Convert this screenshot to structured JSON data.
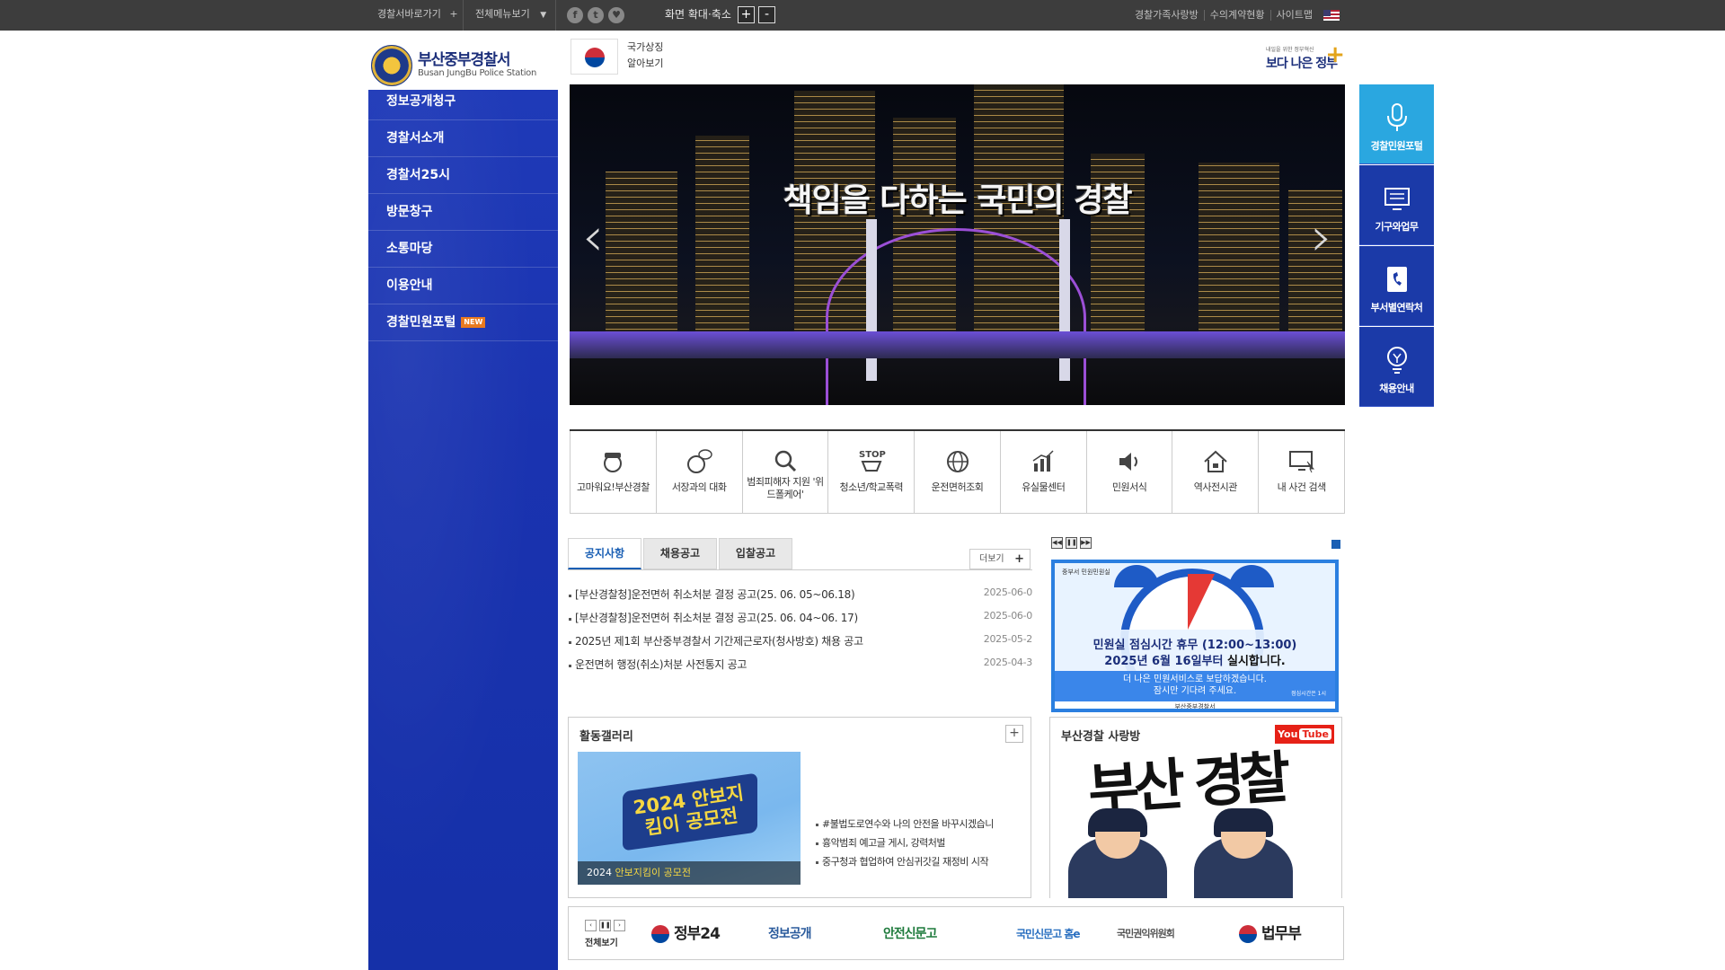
{
  "topbar": {
    "shortcut_label": "경찰서바로가기",
    "allmenu_label": "전체메뉴보기",
    "zoom_label": "화면 확대·축소",
    "zoom_in": "+",
    "zoom_out": "-",
    "links": [
      "경찰가족사랑방",
      "수의계약현황",
      "사이트맵"
    ]
  },
  "logo": {
    "korean": "부산중부경찰서",
    "english": "Busan JungBu Police Station"
  },
  "national_symbol": {
    "line1": "국가상징",
    "line2": "알아보기"
  },
  "gov_logo": {
    "slogan": "내일을 위한 정부혁신",
    "text": "보다 나은 정부"
  },
  "nav": {
    "items": [
      "정보공개청구",
      "경찰서소개",
      "경찰서25시",
      "방문창구",
      "소통마당",
      "이용안내",
      "경찰민원포털"
    ],
    "new_badge": "NEW"
  },
  "hero": {
    "title": "책임을 다하는 국민의 경찰",
    "prev": "‹",
    "next": "›"
  },
  "quick_menu": [
    {
      "label": "고마워요!부산경찰",
      "icon": "police-officer-icon"
    },
    {
      "label": "서장과의 대화",
      "icon": "chat-icon"
    },
    {
      "label": "범죄피해자 지원 '위드폴케어'",
      "icon": "magnifier-icon"
    },
    {
      "label": "청소년/학교폭력",
      "icon": "stop-icon"
    },
    {
      "label": "운전면허조회",
      "icon": "globe-icon"
    },
    {
      "label": "유실물센터",
      "icon": "chart-icon"
    },
    {
      "label": "민원서식",
      "icon": "speaker-icon"
    },
    {
      "label": "역사전시관",
      "icon": "house-icon"
    },
    {
      "label": "내 사건 검색",
      "icon": "monitor-icon"
    }
  ],
  "notice_tabs": [
    "공지사항",
    "채용공고",
    "입찰공고"
  ],
  "more_label": "더보기",
  "notices": [
    {
      "title": "[부산경찰청]운전면허 취소처분 결정 공고(25. 06. 05~06.18)",
      "date": "2025-06-0"
    },
    {
      "title": "[부산경찰청]운전면허 취소처분 결정 공고(25. 06. 04~06. 17)",
      "date": "2025-06-0"
    },
    {
      "title": "2025년 제1회 부산중부경찰서 기간제근로자(청사방호) 채용 공고",
      "date": "2025-05-2"
    },
    {
      "title": "운전면허 행정(취소)처분 사전통지 공고",
      "date": "2025-04-3"
    }
  ],
  "banner": {
    "controls": [
      "◀◀",
      "❚❚",
      "▶▶"
    ],
    "head": "중부서 민원민원실",
    "line1": "민원실 점심시간 휴무 (12:00~13:00)",
    "line2_a": "2025년 6월 16일부터",
    "line2_b": " 실시합니다.",
    "line3": "더 나은 민원서비스로 보답하겠습니다.",
    "line4": "잠시만 기다려 주세요.",
    "tiny": "점심시간은 1시",
    "footer": "부산중부경찰서"
  },
  "gallery": {
    "title": "활동갤러리",
    "plus": "+",
    "image_text": "2024 안보지킴이 공모전",
    "caption_a": "2024 ",
    "caption_b": "안보지킴이 공모전",
    "items": [
      "#불법도로연수와 나의 안전을 바꾸시겠습니",
      "흉악범죄 예고글 게시, 강력처벌",
      "중구청과 협업하여 안심귀갓길 재정비 시작"
    ]
  },
  "youtube": {
    "title": "부산경찰 사랑방",
    "logo_a": "You",
    "logo_b": "Tube",
    "calligraphy": "부산 경찰"
  },
  "partners": {
    "controls": [
      "‹",
      "❚❚",
      "›"
    ],
    "all_label": "전체보기",
    "logos": [
      "정부24",
      "정보공개",
      "안전신문고",
      "국민신문고 홈e",
      "국민권익위원회",
      "법무부"
    ]
  },
  "side_quick": [
    {
      "label": "경찰민원포털",
      "icon": "microphone-icon"
    },
    {
      "label": "기구와업무",
      "icon": "screen-icon"
    },
    {
      "label": "부서별연락처",
      "icon": "phone-book-icon"
    },
    {
      "label": "채용안내",
      "icon": "lightbulb-icon"
    }
  ],
  "colors": {
    "nav_blue": "#1f3ab8",
    "accent_blue": "#1a5fb4",
    "topbar": "#3d3d3d",
    "quick_cyan": "#2aa7e0"
  }
}
